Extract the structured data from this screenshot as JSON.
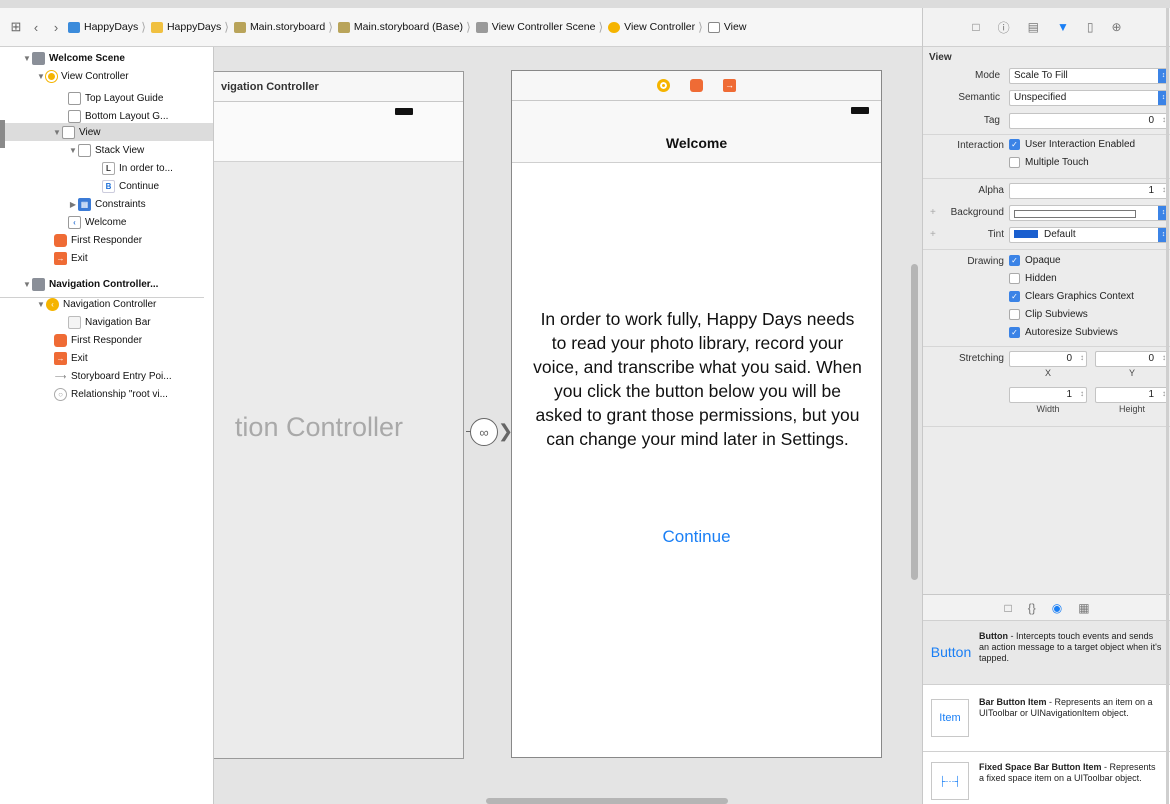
{
  "jumpbar": {
    "crumbs": [
      {
        "label": "HappyDays",
        "icon": "project-icon"
      },
      {
        "label": "HappyDays",
        "icon": "folder-icon"
      },
      {
        "label": "Main.storyboard",
        "icon": "storyboard-icon"
      },
      {
        "label": "Main.storyboard (Base)",
        "icon": "storyboard-icon"
      },
      {
        "label": "View Controller Scene",
        "icon": "scene-icon"
      },
      {
        "label": "View Controller",
        "icon": "view-controller-icon"
      },
      {
        "label": "View",
        "icon": "view-icon"
      }
    ]
  },
  "outline": {
    "welcome_scene": "Welcome Scene",
    "view_controller": "View Controller",
    "top_layout_guide": "Top Layout Guide",
    "bottom_layout_guide": "Bottom Layout G...",
    "view": "View",
    "stack_view": "Stack View",
    "label_item": "In order to...",
    "label_icon": "L",
    "button_item": "Continue",
    "button_icon": "B",
    "constraints": "Constraints",
    "welcome_item": "Welcome",
    "first_responder": "First Responder",
    "exit": "Exit",
    "nav_scene": "Navigation Controller...",
    "nav_controller": "Navigation Controller",
    "nav_bar": "Navigation Bar",
    "first_responder_2": "First Responder",
    "exit_2": "Exit",
    "entry_point": "Storyboard Entry Poi...",
    "relationship": "Relationship \"root vi..."
  },
  "canvas": {
    "nav_frame_title": "vigation Controller",
    "nav_frame_big": "tion Controller",
    "phone": {
      "title": "Welcome",
      "body": "In order to work fully, Happy Days needs to read your photo library, record your voice, and transcribe what you said. When you click the button below you will be asked to grant those permissions, but you can change your mind later in Settings.",
      "continue": "Continue"
    }
  },
  "inspector": {
    "section": "View",
    "mode_label": "Mode",
    "mode_value": "Scale To Fill",
    "semantic_label": "Semantic",
    "semantic_value": "Unspecified",
    "tag_label": "Tag",
    "tag_value": "0",
    "interaction_label": "Interaction",
    "user_interaction": "User Interaction Enabled",
    "multiple_touch": "Multiple Touch",
    "alpha_label": "Alpha",
    "alpha_value": "1",
    "background_label": "Background",
    "tint_label": "Tint",
    "tint_value": "Default",
    "drawing_label": "Drawing",
    "opaque": "Opaque",
    "hidden": "Hidden",
    "clears_context": "Clears Graphics Context",
    "clip_subviews": "Clip Subviews",
    "autoresize": "Autoresize Subviews",
    "stretching_label": "Stretching",
    "stretch_x": "0",
    "stretch_y": "0",
    "stretch_w": "1",
    "stretch_h": "1",
    "x_label": "X",
    "y_label": "Y",
    "width_label": "Width",
    "height_label": "Height",
    "checked": {
      "user_interaction": true,
      "multiple_touch": false,
      "opaque": true,
      "hidden": false,
      "clears_context": true,
      "clip_subviews": false,
      "autoresize": true
    },
    "accent_color": "#3b83e6"
  },
  "library": {
    "items": [
      {
        "icon_text": "Button",
        "title": "Button",
        "desc": " - Intercepts touch events and sends an action message to a target object when it's tapped."
      },
      {
        "icon_text": "Item",
        "title": "Bar Button Item",
        "desc": " - Represents an item on a UIToolbar or UINavigationItem object."
      },
      {
        "icon_text": "",
        "title": "Fixed Space Bar Button Item",
        "desc": " - Represents a fixed space item on a UIToolbar object."
      }
    ]
  }
}
